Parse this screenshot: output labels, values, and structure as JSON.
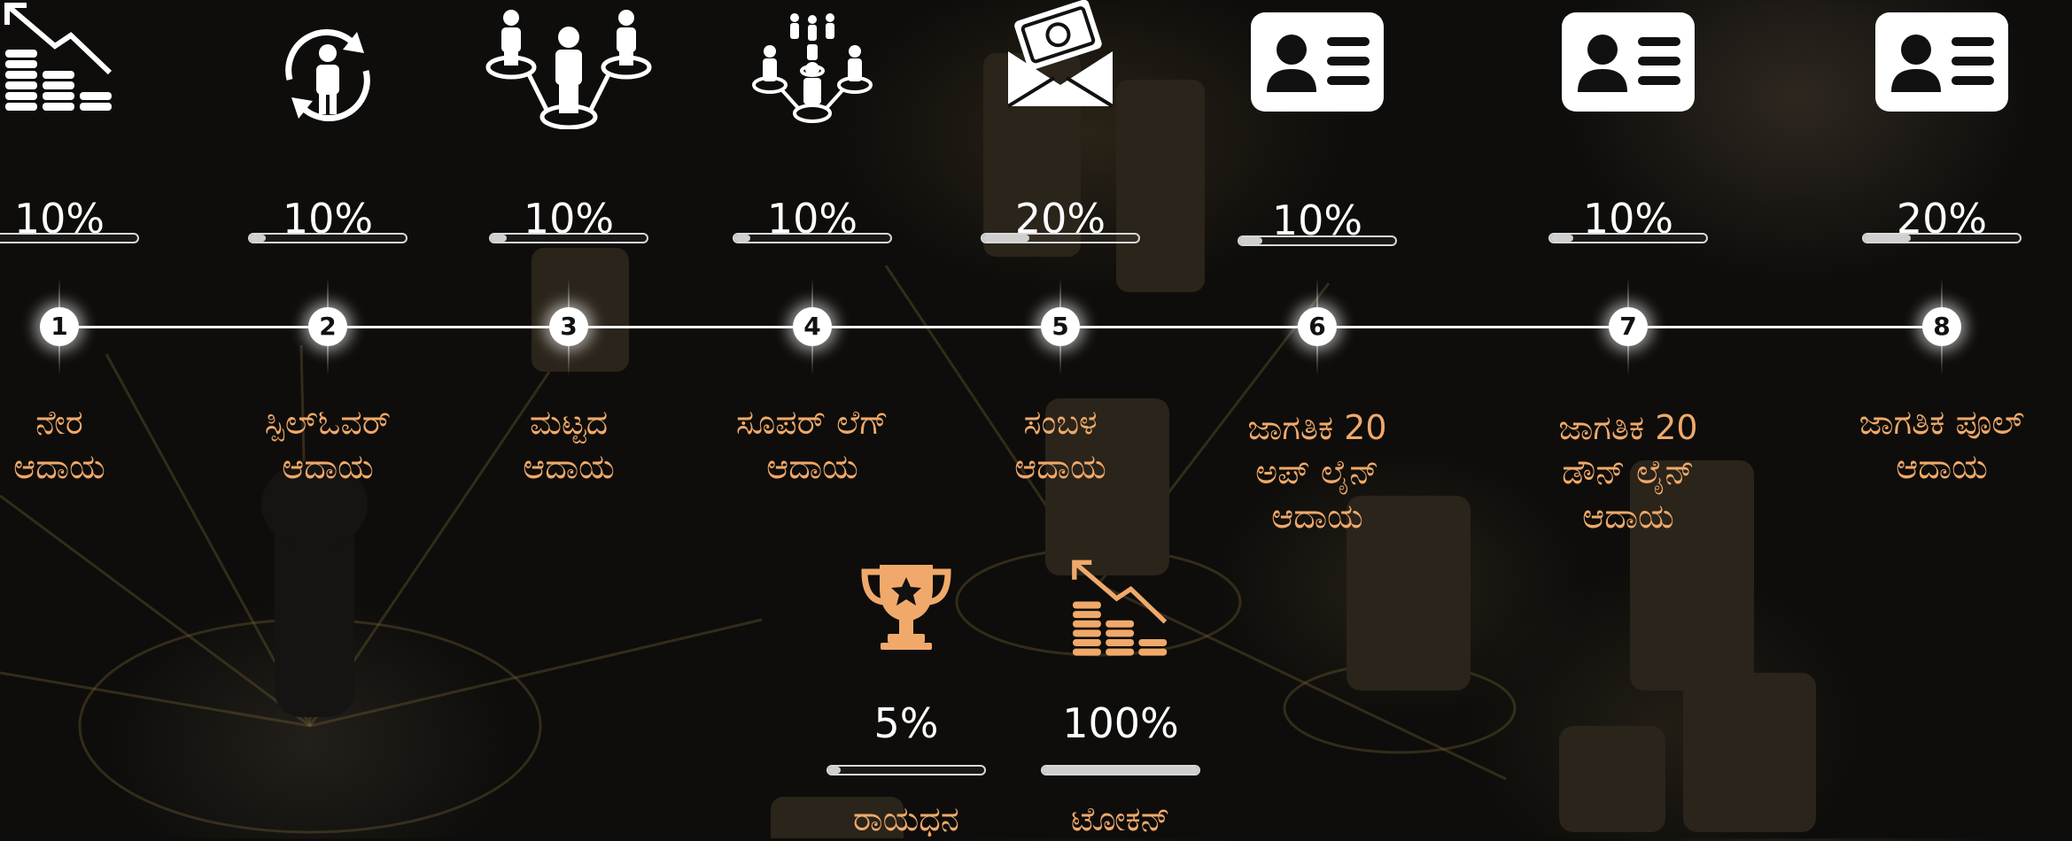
{
  "colors": {
    "accent": "#f0a96a",
    "text": "#ffffff",
    "bar": "#cfcfcf",
    "background": "#0e0d0b"
  },
  "steps": [
    {
      "number": "1",
      "percent": "10%",
      "fraction": 0.1,
      "label_lines": [
        "ನೇರ",
        "ಆದಾಯ"
      ],
      "icon": "descending-coins-icon"
    },
    {
      "number": "2",
      "percent": "10%",
      "fraction": 0.1,
      "label_lines": [
        "ಸ್ಪಿಲ್‌ಓವರ್",
        "ಆದಾಯ"
      ],
      "icon": "circular-person-icon"
    },
    {
      "number": "3",
      "percent": "10%",
      "fraction": 0.1,
      "label_lines": [
        "ಮಟ್ಟದ",
        "ಆದಾಯ"
      ],
      "icon": "network-people-icon"
    },
    {
      "number": "4",
      "percent": "10%",
      "fraction": 0.1,
      "label_lines": [
        "ಸೂಪರ್ ಲೆಗ್",
        "ಆದಾಯ"
      ],
      "icon": "hierarchy-people-icon"
    },
    {
      "number": "5",
      "percent": "20%",
      "fraction": 0.3,
      "label_lines": [
        "ಸಂಬಳ",
        "ಆದಾಯ"
      ],
      "icon": "money-envelope-icon"
    },
    {
      "number": "6",
      "percent": "10%",
      "fraction": 0.15,
      "label_lines": [
        "ಜಾಗತಿಕ 20",
        "ಅಪ್ ಲೈನ್",
        "ಆದಾಯ"
      ],
      "icon": "id-card-icon"
    },
    {
      "number": "7",
      "percent": "10%",
      "fraction": 0.15,
      "label_lines": [
        "ಜಾಗತಿಕ 20",
        "ಡೌನ್ ಲೈನ್",
        "ಆದಾಯ"
      ],
      "icon": "id-card-icon"
    },
    {
      "number": "8",
      "percent": "20%",
      "fraction": 0.3,
      "label_lines": [
        "ಜಾಗತಿಕ ಪೂಲ್",
        "ಆದಾಯ"
      ],
      "icon": "id-card-icon"
    }
  ],
  "extras": [
    {
      "percent": "5%",
      "fraction": 0.08,
      "label_lines": [
        "ರಾಯಧನ"
      ],
      "icon": "trophy-icon"
    },
    {
      "percent": "100%",
      "fraction": 1.0,
      "label_lines": [
        "ಟೋಕನ್"
      ],
      "icon": "descending-coins-icon"
    }
  ]
}
